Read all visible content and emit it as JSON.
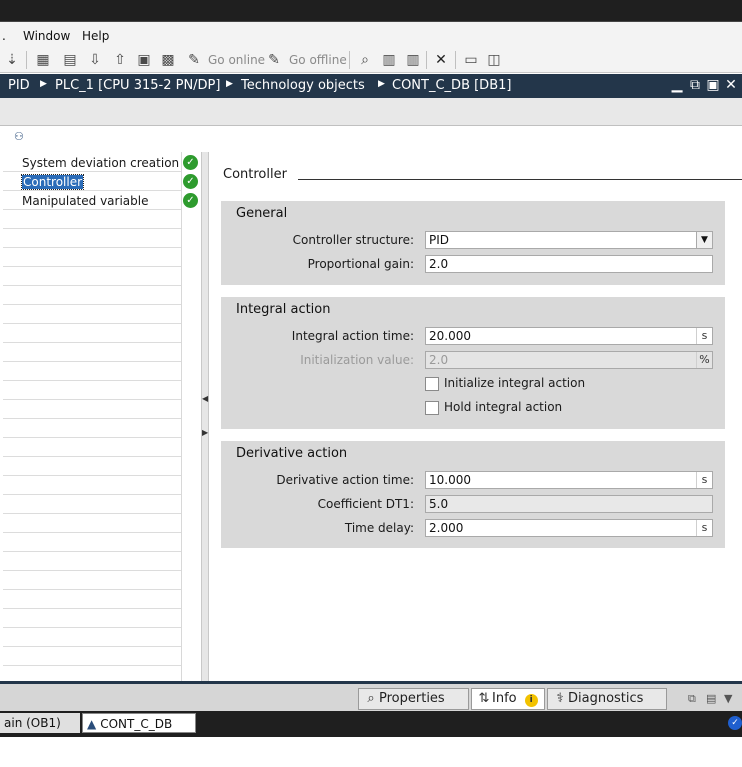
{
  "menu": {
    "window": "Window",
    "help": "Help"
  },
  "toolbar": {
    "go_online": "Go online",
    "go_offline": "Go offline",
    "icons": [
      "download-icon",
      "compile-icon",
      "upload-icon",
      "simulate-icon",
      "go-online-icon",
      "go-offline-icon",
      "accessible-devices-icon",
      "split-horizontal-icon",
      "split-vertical-icon",
      "close-x-icon"
    ]
  },
  "breadcrumb": {
    "items": [
      "PID",
      "PLC_1 [CPU 315-2 PN/DP]",
      "Technology objects",
      "CONT_C_DB [DB1]"
    ],
    "controls": {
      "minimize": "▁",
      "restore": "⧉",
      "maximize": "▣",
      "close": "✕"
    }
  },
  "nav": {
    "items": [
      {
        "label": "System deviation creation",
        "status": "ok"
      },
      {
        "label": "Controller",
        "status": "ok",
        "selected": true
      },
      {
        "label": "Manipulated variable",
        "status": "ok"
      }
    ]
  },
  "content": {
    "section_title": "Controller",
    "general": {
      "title": "General",
      "controller_structure_label": "Controller structure:",
      "controller_structure_value": "PID",
      "proportional_gain_label": "Proportional gain:",
      "proportional_gain_value": "2.0"
    },
    "integral": {
      "title": "Integral action",
      "time_label": "Integral action time:",
      "time_value": "20.000",
      "time_unit": "s",
      "init_label": "Initialization value:",
      "init_value": "2.0",
      "init_unit": "%",
      "init_checkbox_label": "Initialize integral action",
      "hold_checkbox_label": "Hold integral action"
    },
    "derivative": {
      "title": "Derivative action",
      "time_label": "Derivative action time:",
      "time_value": "10.000",
      "time_unit": "s",
      "coeff_label": "Coefficient DT1:",
      "coeff_value": "5.0",
      "delay_label": "Time delay:",
      "delay_value": "2.000",
      "delay_unit": "s"
    }
  },
  "bottom_tabs": {
    "properties": "Properties",
    "info": "Info",
    "diagnostics": "Diagnostics"
  },
  "taskbar": {
    "task1": "ain (OB1)",
    "task2": "CONT_C_DB"
  },
  "colors": {
    "accent_dark": "#23364a",
    "selection": "#2b6cb8",
    "ok_green": "#2e9b2e"
  }
}
